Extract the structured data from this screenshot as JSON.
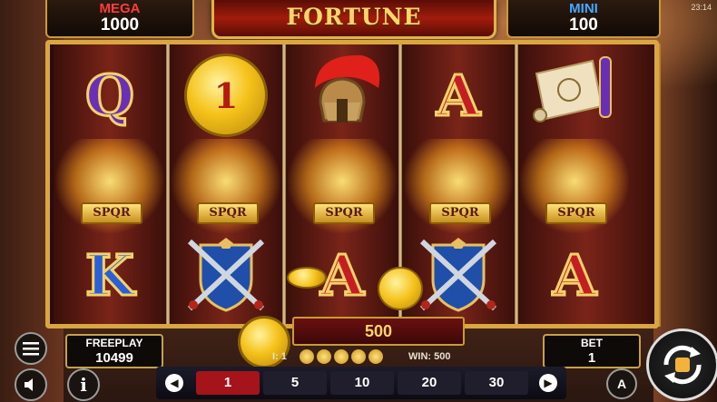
{
  "title": "FORTUNE",
  "clock": "23:14",
  "jackpots": {
    "mega": {
      "label": "MEGA",
      "value": "1000"
    },
    "mini": {
      "label": "MINI",
      "value": "100"
    }
  },
  "reels": [
    {
      "top": "Q",
      "middle": "SPQR",
      "bottom": "K"
    },
    {
      "top": "1",
      "middle": "SPQR",
      "bottom": "shield"
    },
    {
      "top": "helmet",
      "middle": "SPQR",
      "bottom": "A"
    },
    {
      "top": "A",
      "middle": "SPQR",
      "bottom": "shield"
    },
    {
      "top": "scroll",
      "middle": "SPQR",
      "bottom": "A"
    }
  ],
  "win_display": {
    "value": "500"
  },
  "info_strip": {
    "lines_label": "I: 1",
    "win_label": "WIN: 500"
  },
  "freeplay": {
    "label": "FREEPLAY",
    "value": "10499"
  },
  "bet": {
    "label": "BET",
    "value": "1"
  },
  "bet_options": [
    "1",
    "5",
    "10",
    "20",
    "30"
  ],
  "selected_bet": "1",
  "buttons": {
    "auto": "A",
    "info": "i"
  },
  "colors": {
    "accent_gold": "#d9a640",
    "selected_bet": "#a5141a",
    "mega": "#ff3a3a",
    "mini": "#45a8ff"
  }
}
